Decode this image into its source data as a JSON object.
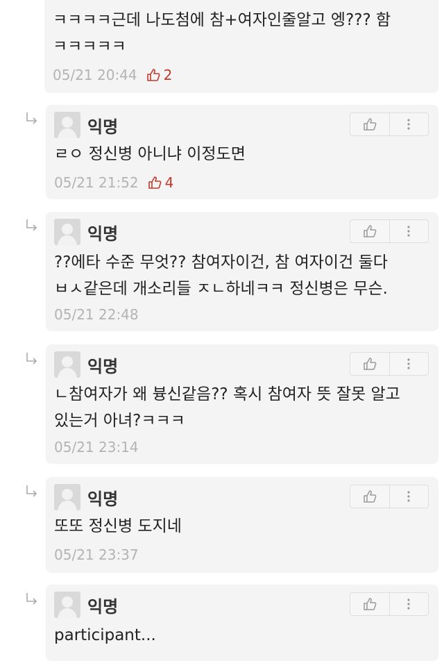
{
  "comments": [
    {
      "author": "",
      "text": "ㅋㅋㅋㅋ근데 나도첨에 참+여자인줄알고 엥??? 함\nㅋㅋㅋㅋㅋ",
      "time": "05/21 20:44",
      "likes": "2",
      "is_reply": false
    },
    {
      "author": "익명",
      "text": "ㄹㅇ 정신병 아니냐 이정도면",
      "time": "05/21 21:52",
      "likes": "4",
      "is_reply": true
    },
    {
      "author": "익명",
      "text": "??에타 수준 무엇?? 참여자이건, 참 여자이건 둘다\nㅂㅅ같은데 개소리들 ㅈㄴ하네ㅋㅋ 정신병은 무슨.",
      "time": "05/21 22:48",
      "likes": "",
      "is_reply": true
    },
    {
      "author": "익명",
      "text": "ㄴ참여자가 왜 븅신같음?? 혹시 참여자 뜻 잘못 알고\n있는거 아녀?ㅋㅋㅋ",
      "time": "05/21 23:14",
      "likes": "",
      "is_reply": true
    },
    {
      "author": "익명",
      "text": "또또 정신병 도지네",
      "time": "05/21 23:37",
      "likes": "",
      "is_reply": true
    },
    {
      "author": "익명",
      "text": "participant...",
      "time": "",
      "likes": "",
      "is_reply": true
    }
  ],
  "icons": {
    "like": "thumbs-up-icon",
    "more": "more-vertical-icon",
    "reply": "reply-arrow-icon"
  },
  "colors": {
    "like_count": "#c0392b",
    "card_bg": "#f4f4f4",
    "meta": "#b3b3b3"
  }
}
